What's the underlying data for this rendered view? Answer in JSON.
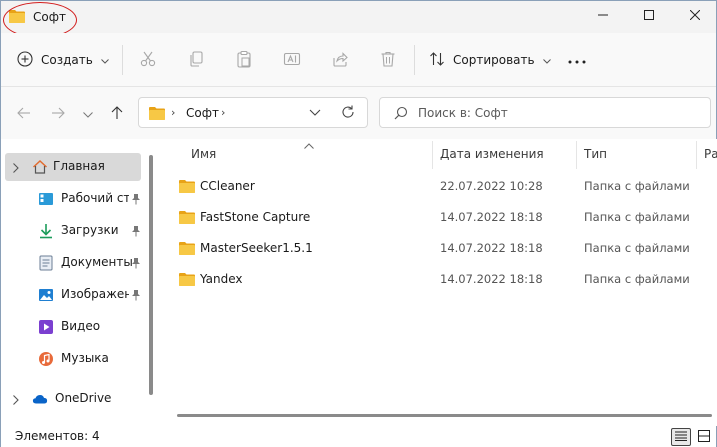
{
  "window": {
    "title": "Софт"
  },
  "command_bar": {
    "create_label": "Создать",
    "sort_label": "Сортировать"
  },
  "address_bar": {
    "path": [
      "Софт"
    ]
  },
  "search": {
    "placeholder": "Поиск в: Софт"
  },
  "sidebar": {
    "items": [
      {
        "label": "Главная",
        "icon": "home-icon",
        "expandable": true,
        "active": true
      },
      {
        "label": "Рабочий сто",
        "icon": "desktop-icon",
        "pinned": true
      },
      {
        "label": "Загрузки",
        "icon": "downloads-icon",
        "pinned": true
      },
      {
        "label": "Документы",
        "icon": "documents-icon",
        "pinned": true
      },
      {
        "label": "Изображен",
        "icon": "pictures-icon",
        "pinned": true
      },
      {
        "label": "Видео",
        "icon": "video-icon"
      },
      {
        "label": "Музыка",
        "icon": "music-icon"
      },
      {
        "label": "OneDrive",
        "icon": "cloud-icon",
        "expandable": true
      }
    ]
  },
  "file_list": {
    "columns": [
      "Имя",
      "Дата изменения",
      "Тип",
      "Ра"
    ],
    "rows": [
      {
        "name": "CCleaner",
        "date": "22.07.2022 10:28",
        "type": "Папка с файлами"
      },
      {
        "name": "FastStone Capture",
        "date": "14.07.2022 18:18",
        "type": "Папка с файлами"
      },
      {
        "name": "MasterSeeker1.5.1",
        "date": "14.07.2022 18:18",
        "type": "Папка с файлами"
      },
      {
        "name": "Yandex",
        "date": "14.07.2022 18:18",
        "type": "Папка с файлами"
      }
    ]
  },
  "status_bar": {
    "item_count": "Элементов: 4"
  },
  "colors": {
    "folder": "#f7c845",
    "folder_dark": "#e8a317",
    "annotation_red": "#d21d1d",
    "accent_blue": "#0067c0"
  }
}
